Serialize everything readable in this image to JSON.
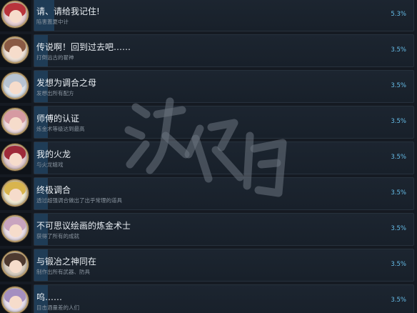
{
  "colors": {
    "background": "#151a22",
    "bar": "#1c2530",
    "progress_fill": "#1f3c56",
    "title_text": "#e9eef3",
    "desc_text": "#8a95a0",
    "percent_text": "#66bde8",
    "badge_border": "#b59a6a"
  },
  "achievements": [
    {
      "title": "请、请给我记住!",
      "desc": "陷害蓋夏中计",
      "percent": "5.3%",
      "progress": 0.053,
      "icon": "girl-portrait-red-icon"
    },
    {
      "title": "传说啊！回到过去吧……",
      "desc": "打倒远古的翟神",
      "percent": "3.5%",
      "progress": 0.035,
      "icon": "girl-portrait-brown-icon"
    },
    {
      "title": "发想为调合之母",
      "desc": "发想出所有配方",
      "percent": "3.5%",
      "progress": 0.035,
      "icon": "girl-portrait-silver-icon"
    },
    {
      "title": "师傅的认证",
      "desc": "炼金术等级达到最高",
      "percent": "3.5%",
      "progress": 0.035,
      "icon": "girl-portrait-pink-icon"
    },
    {
      "title": "我的火龙",
      "desc": "与火龙嬉戏",
      "percent": "3.5%",
      "progress": 0.035,
      "icon": "girl-portrait-crimson-icon"
    },
    {
      "title": "终极调合",
      "desc": "透过超强调合做出了出乎常理的道具",
      "percent": "3.5%",
      "progress": 0.035,
      "icon": "girl-portrait-blonde-icon"
    },
    {
      "title": "不可思议绘画的炼金术士",
      "desc": "获得了所有的成就",
      "percent": "3.5%",
      "progress": 0.035,
      "icon": "girl-portrait-group-icon"
    },
    {
      "title": "与锻冶之神同在",
      "desc": "制作出所有武器、防具",
      "percent": "3.5%",
      "progress": 0.035,
      "icon": "girl-portrait-dark-icon"
    },
    {
      "title": "呜……",
      "desc": "目击酒量差的人们",
      "percent": "3.5%",
      "progress": 0.035,
      "icon": "girl-portrait-lavender-icon"
    }
  ]
}
